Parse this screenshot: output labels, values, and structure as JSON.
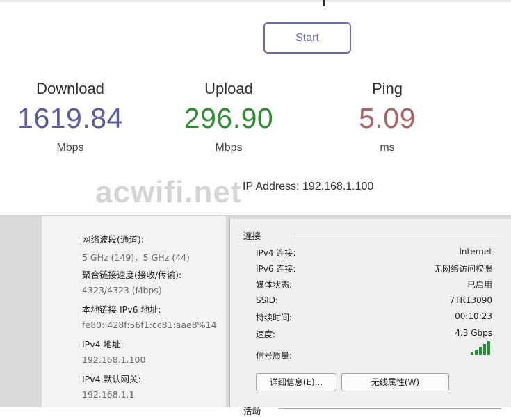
{
  "speedtest": {
    "start_label": "Start",
    "download": {
      "label": "Download",
      "value": "1619.84",
      "unit": "Mbps",
      "color": "#5b5a9c"
    },
    "upload": {
      "label": "Upload",
      "value": "296.90",
      "unit": "Mbps",
      "color": "#2e8b32"
    },
    "ping": {
      "label": "Ping",
      "value": "5.09",
      "unit": "ms",
      "color": "#a86363"
    },
    "ip_address": "IP Address: 192.168.1.100",
    "watermark": "acwifi.net"
  },
  "details": {
    "items": [
      {
        "key": "网络波段(通道):",
        "value": "5 GHz (149)，5 GHz (44)"
      },
      {
        "key": "聚合链接速度(接收/传输):",
        "value": "4323/4323 (Mbps)"
      },
      {
        "key": "本地链接 IPv6 地址:",
        "value": "fe80::428f:56f1:cc81:aae8%14"
      },
      {
        "key": "IPv4 地址:",
        "value": "192.168.1.100"
      },
      {
        "key": "IPv4 默认网关:",
        "value": "192.168.1.1"
      }
    ]
  },
  "connection": {
    "section_title": "连接",
    "rows": [
      {
        "label": "IPv4 连接:",
        "value": "Internet"
      },
      {
        "label": "IPv6 连接:",
        "value": "无网络访问权限"
      },
      {
        "label": "媒体状态:",
        "value": "已启用"
      },
      {
        "label": "SSID:",
        "value": "7TR13090"
      },
      {
        "label": "持续时间:",
        "value": "00:10:23"
      },
      {
        "label": "速度:",
        "value": "4.3 Gbps"
      }
    ],
    "signal_label": "信号质量:",
    "signal_level": 5,
    "signal_max": 5,
    "details_button": "详细信息(E)...",
    "wireless_button": "无线属性(W)",
    "activity_title": "活动"
  }
}
